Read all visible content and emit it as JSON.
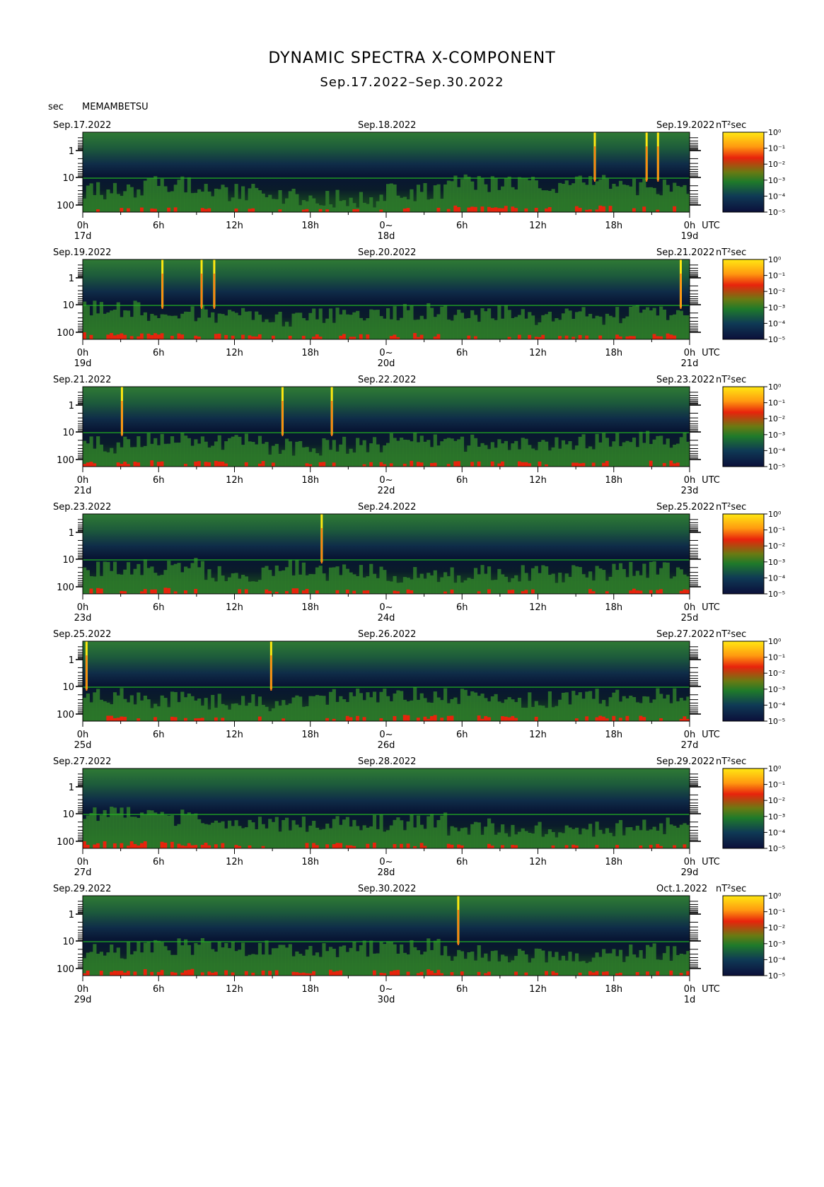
{
  "title": "DYNAMIC SPECTRA X-COMPONENT",
  "subtitle": "Sep.17.2022–Sep.30.2022",
  "yunit": "sec",
  "station": "MEMAMBETSU",
  "colorbar_unit": "nT²sec",
  "time_zone_label": "UTC",
  "colors": {
    "low": "#0b0f3a",
    "mid": "#1f7a2a",
    "high": "#e8230c",
    "top": "#ffe812"
  },
  "chart_data": [
    {
      "type": "heatmap",
      "panel": 1,
      "start_date_label": "Sep.17.2022",
      "mid_date_label": "Sep.18.2022",
      "end_date_label": "Sep.19.2022",
      "xticks": [
        "0h",
        "6h",
        "12h",
        "18h",
        "0~",
        "6h",
        "12h",
        "18h",
        "0h"
      ],
      "day_labels": [
        "17d",
        "18d",
        "19d"
      ],
      "yticks": [
        "1",
        "10",
        "100"
      ],
      "ylabel": "sec",
      "colorbar_ticks": [
        "10⁰",
        "10⁻¹",
        "10⁻²",
        "10⁻³",
        "10⁻⁴",
        "10⁻⁵"
      ],
      "bursts_hours": [
        40.5,
        44.6,
        45.5
      ],
      "activity": [
        0.35,
        0.5,
        0.3,
        0.15,
        0.12,
        0.3,
        0.55,
        0.5,
        0.6,
        0.45
      ]
    },
    {
      "type": "heatmap",
      "panel": 2,
      "start_date_label": "Sep.19.2022",
      "mid_date_label": "Sep.20.2022",
      "end_date_label": "Sep.21.2022",
      "xticks": [
        "0h",
        "6h",
        "12h",
        "18h",
        "0~",
        "6h",
        "12h",
        "18h",
        "0h"
      ],
      "day_labels": [
        "19d",
        "20d",
        "21d"
      ],
      "yticks": [
        "1",
        "10",
        "100"
      ],
      "ylabel": "sec",
      "colorbar_ticks": [
        "10⁰",
        "10⁻¹",
        "10⁻²",
        "10⁻³",
        "10⁻⁴",
        "10⁻⁵"
      ],
      "bursts_hours": [
        6.3,
        9.4,
        10.4,
        47.3
      ],
      "activity": [
        0.6,
        0.5,
        0.45,
        0.35,
        0.4,
        0.5,
        0.45,
        0.35,
        0.4,
        0.45
      ]
    },
    {
      "type": "heatmap",
      "panel": 3,
      "start_date_label": "Sep.21.2022",
      "mid_date_label": "Sep.22.2022",
      "end_date_label": "Sep.23.2022",
      "xticks": [
        "0h",
        "6h",
        "12h",
        "18h",
        "0~",
        "6h",
        "12h",
        "18h",
        "0h"
      ],
      "day_labels": [
        "21d",
        "22d",
        "23d"
      ],
      "yticks": [
        "1",
        "10",
        "100"
      ],
      "ylabel": "sec",
      "colorbar_ticks": [
        "10⁰",
        "10⁻¹",
        "10⁻²",
        "10⁻³",
        "10⁻⁴",
        "10⁻⁵"
      ],
      "bursts_hours": [
        3.1,
        15.8,
        19.7
      ],
      "activity": [
        0.35,
        0.5,
        0.45,
        0.3,
        0.35,
        0.45,
        0.4,
        0.4,
        0.45,
        0.5
      ]
    },
    {
      "type": "heatmap",
      "panel": 4,
      "start_date_label": "Sep.23.2022",
      "mid_date_label": "Sep.24.2022",
      "end_date_label": "Sep.25.2022",
      "xticks": [
        "0h",
        "6h",
        "12h",
        "18h",
        "0~",
        "6h",
        "12h",
        "18h",
        "0h"
      ],
      "day_labels": [
        "23d",
        "24d",
        "25d"
      ],
      "yticks": [
        "1",
        "10",
        "100"
      ],
      "ylabel": "sec",
      "colorbar_ticks": [
        "10⁰",
        "10⁻¹",
        "10⁻²",
        "10⁻³",
        "10⁻⁴",
        "10⁻⁵"
      ],
      "bursts_hours": [
        18.9
      ],
      "activity": [
        0.45,
        0.5,
        0.3,
        0.45,
        0.35,
        0.3,
        0.3,
        0.3,
        0.35,
        0.4
      ]
    },
    {
      "type": "heatmap",
      "panel": 5,
      "start_date_label": "Sep.25.2022",
      "mid_date_label": "Sep.26.2022",
      "end_date_label": "Sep.27.2022",
      "xticks": [
        "0h",
        "6h",
        "12h",
        "18h",
        "0~",
        "6h",
        "12h",
        "18h",
        "0h"
      ],
      "day_labels": [
        "25d",
        "26d",
        "27d"
      ],
      "yticks": [
        "1",
        "10",
        "100"
      ],
      "ylabel": "sec",
      "colorbar_ticks": [
        "10⁰",
        "10⁻¹",
        "10⁻²",
        "10⁻³",
        "10⁻⁴",
        "10⁻⁵"
      ],
      "bursts_hours": [
        0.3,
        14.9
      ],
      "activity": [
        0.45,
        0.35,
        0.3,
        0.25,
        0.4,
        0.5,
        0.45,
        0.35,
        0.4,
        0.45
      ]
    },
    {
      "type": "heatmap",
      "panel": 6,
      "start_date_label": "Sep.27.2022",
      "mid_date_label": "Sep.28.2022",
      "end_date_label": "Sep.29.2022",
      "xticks": [
        "0h",
        "6h",
        "12h",
        "18h",
        "0~",
        "6h",
        "12h",
        "18h",
        "0h"
      ],
      "day_labels": [
        "27d",
        "28d",
        "29d"
      ],
      "yticks": [
        "1",
        "10",
        "100"
      ],
      "ylabel": "sec",
      "colorbar_ticks": [
        "10⁰",
        "10⁻¹",
        "10⁻²",
        "10⁻³",
        "10⁻⁴",
        "10⁻⁵"
      ],
      "bursts_hours": [],
      "activity": [
        0.7,
        0.6,
        0.45,
        0.4,
        0.45,
        0.5,
        0.35,
        0.25,
        0.3,
        0.35
      ]
    },
    {
      "type": "heatmap",
      "panel": 7,
      "start_date_label": "Sep.29.2022",
      "mid_date_label": "Sep.30.2022",
      "end_date_label": "Oct.1.2022",
      "xticks": [
        "0h",
        "6h",
        "12h",
        "18h",
        "0~",
        "6h",
        "12h",
        "18h",
        "0h"
      ],
      "day_labels": [
        "29d",
        "30d",
        "1d"
      ],
      "yticks": [
        "1",
        "10",
        "100"
      ],
      "ylabel": "sec",
      "colorbar_ticks": [
        "10⁰",
        "10⁻¹",
        "10⁻²",
        "10⁻³",
        "10⁻⁴",
        "10⁻⁵"
      ],
      "bursts_hours": [
        29.7
      ],
      "activity": [
        0.45,
        0.55,
        0.45,
        0.5,
        0.5,
        0.55,
        0.35,
        0.3,
        0.3,
        0.4
      ]
    }
  ]
}
